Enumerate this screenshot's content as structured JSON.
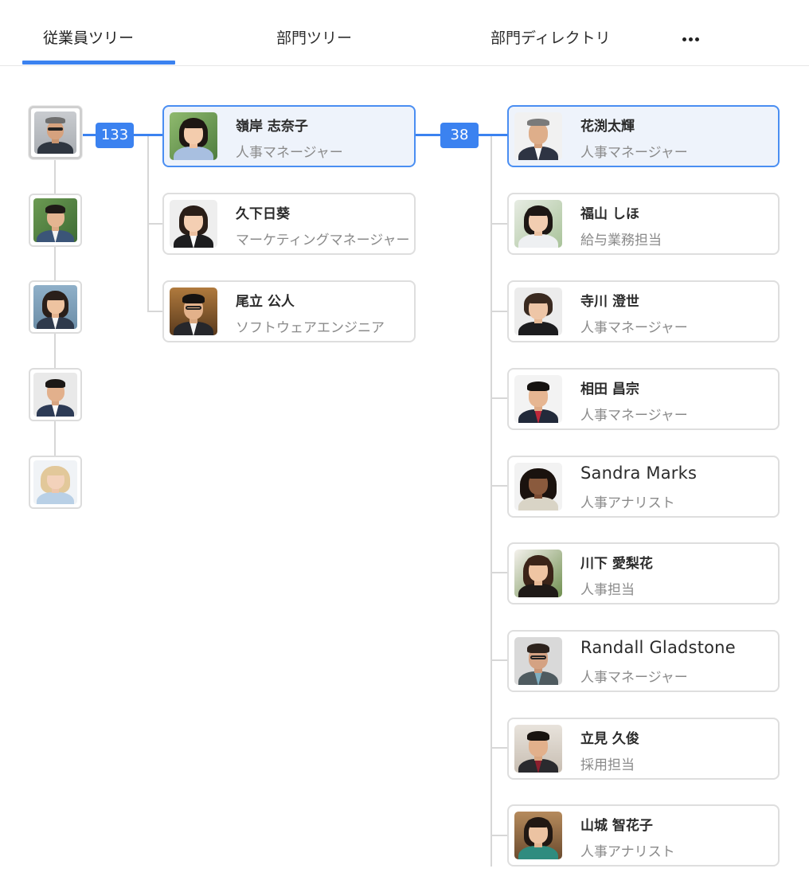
{
  "tabs": [
    {
      "label": "従業員ツリー"
    },
    {
      "label": "部門ツリー"
    },
    {
      "label": "部門ディレクトリ"
    }
  ],
  "more_icon": "more-horizontal-icon",
  "accent_color": "#3b82f0",
  "badges": {
    "root_count": "133",
    "manager_count": "38"
  },
  "column2": [
    {
      "name": "嶺岸 志奈子",
      "role": "人事マネージャー"
    },
    {
      "name": "久下日葵",
      "role": "マーケティングマネージャー"
    },
    {
      "name": "尾立 公人",
      "role": "ソフトウェアエンジニア"
    }
  ],
  "column3": [
    {
      "name": "花渕太輝",
      "role": "人事マネージャー"
    },
    {
      "name": "福山 しほ",
      "role": "給与業務担当"
    },
    {
      "name": "寺川 澄世",
      "role": "人事マネージャー"
    },
    {
      "name": "相田 昌宗",
      "role": "人事マネージャー"
    },
    {
      "name": "Sandra Marks",
      "role": "人事アナリスト"
    },
    {
      "name": "川下 愛梨花",
      "role": "人事担当"
    },
    {
      "name": "Randall Gladstone",
      "role": "人事マネージャー"
    },
    {
      "name": "立見 久俊",
      "role": "採用担当"
    },
    {
      "name": "山城 智花子",
      "role": "人事アナリスト"
    }
  ]
}
